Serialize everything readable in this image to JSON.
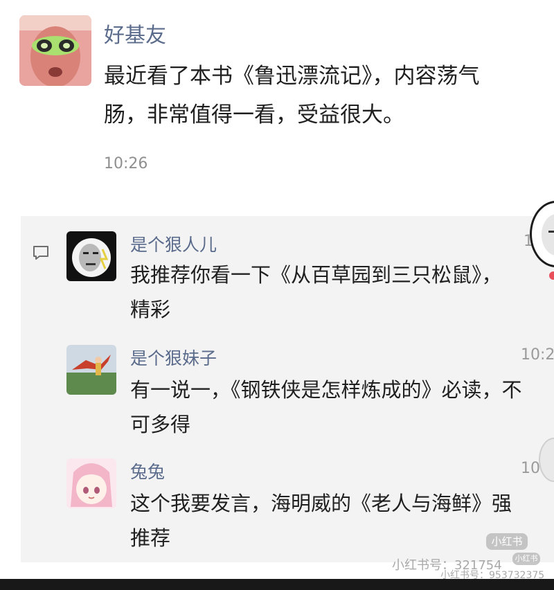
{
  "post": {
    "author": "好基友",
    "text_line1": "最近看了本书《鲁迅漂流记》，内容荡气",
    "text_line2": "肠，非常值得一看，受益很大。",
    "time": "10:26"
  },
  "comments": [
    {
      "author": "是个狠人儿",
      "time": "1",
      "line1": "我推荐你看一下《从百草园到三只松鼠》，",
      "line2": "精彩"
    },
    {
      "author": "是个狠妹子",
      "time": "10:2",
      "line1": "有一说一，《钢铁侠是怎样炼成的》必读，不",
      "line2": "可多得"
    },
    {
      "author": "兔兔",
      "time": "10:",
      "line1": "这个我要发言，海明威的《老人与海鲜》强",
      "line2": "推荐"
    }
  ],
  "watermark": {
    "badge_main": "小红书",
    "id_main": "小红书号：321754",
    "badge_small": "小红书",
    "id_small": "小红书号：953732375"
  },
  "colors": {
    "name_link": "#5a6b8c",
    "comment_bg": "#f3f3f3",
    "text": "#1f1f1f"
  }
}
